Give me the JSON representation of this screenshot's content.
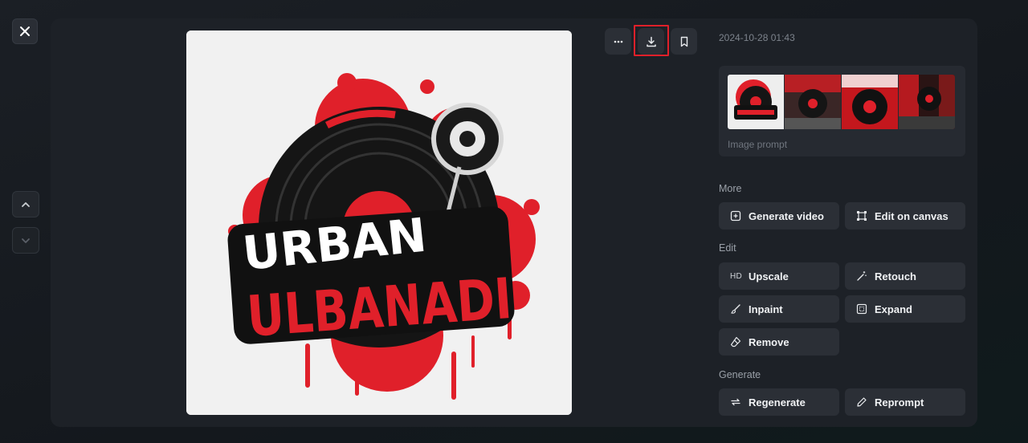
{
  "close": {
    "icon": "close-icon"
  },
  "nav": {
    "up_icon": "chevron-up-icon",
    "down_icon": "chevron-down-icon"
  },
  "image": {
    "logo_line1": "URBAN",
    "logo_line2": "ULBANADI",
    "colors": {
      "record": "#1a1a1a",
      "accent": "#e0202a",
      "background": "#f1f1f1"
    }
  },
  "toolbar": {
    "more_icon": "more-icon",
    "download_icon": "download-icon",
    "bookmark_icon": "bookmark-icon",
    "highlight_color": "#e0202a"
  },
  "timestamp": "2024-10-28 01:43",
  "prompt": {
    "label": "Image prompt",
    "thumbnails": [
      "thumbnail-1",
      "thumbnail-2",
      "thumbnail-3",
      "thumbnail-4"
    ]
  },
  "sections": {
    "more": {
      "label": "More",
      "buttons": [
        {
          "label": "Generate video",
          "icon": "video-plus-icon"
        },
        {
          "label": "Edit on canvas",
          "icon": "canvas-icon"
        }
      ]
    },
    "edit": {
      "label": "Edit",
      "buttons": [
        {
          "label": "Upscale",
          "icon_text": "HD"
        },
        {
          "label": "Retouch",
          "icon": "magic-wand-icon"
        },
        {
          "label": "Inpaint",
          "icon": "brush-icon"
        },
        {
          "label": "Expand",
          "icon": "expand-icon"
        },
        {
          "label": "Remove",
          "icon": "eraser-icon"
        }
      ]
    },
    "generate": {
      "label": "Generate",
      "buttons": [
        {
          "label": "Regenerate",
          "icon": "refresh-icon"
        },
        {
          "label": "Reprompt",
          "icon": "pencil-icon"
        }
      ]
    }
  }
}
